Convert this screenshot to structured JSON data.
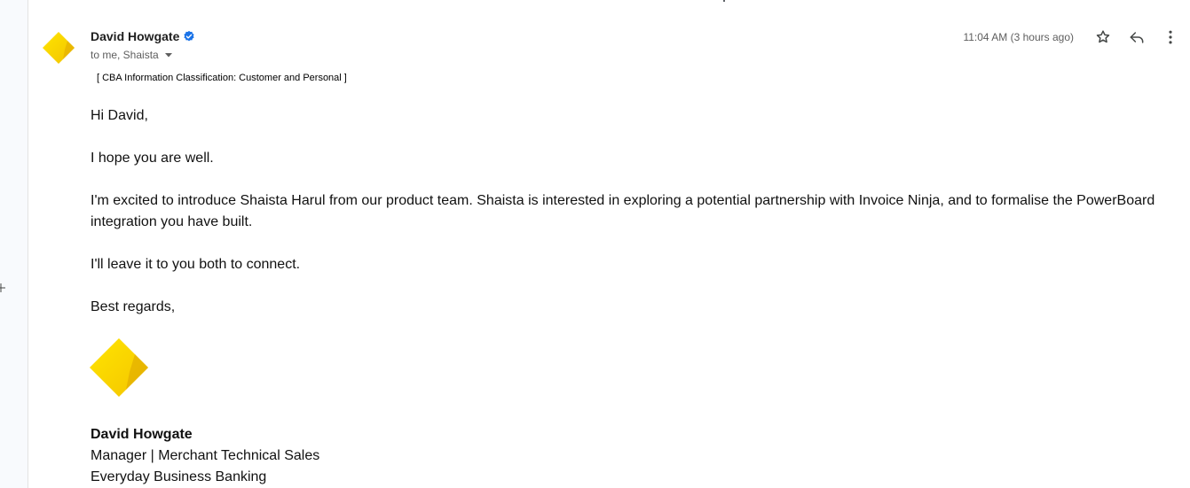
{
  "email": {
    "sender_name": "David Howgate",
    "recipients": "to me, Shaista",
    "timestamp": "11:04 AM (3 hours ago)",
    "classification": "[ CBA Information Classification: Customer and Personal ]",
    "body": {
      "greeting": "Hi David,",
      "line1": "I hope you are well.",
      "line2": "I'm excited to introduce Shaista Harul from our product team. Shaista is interested in exploring a potential partnership with Invoice Ninja, and to formalise the PowerBoard integration you have built.",
      "line3": "I'll leave it to you both to connect.",
      "closing": "Best regards,"
    },
    "signature": {
      "name": "David Howgate",
      "title": "Manager | Merchant Technical Sales",
      "department": "Everyday Business Banking"
    }
  },
  "icons": {
    "avatar": "cba-diamond-logo",
    "verified": "verified-badge-icon",
    "star": "star-icon",
    "reply": "reply-icon",
    "more": "more-vert-icon",
    "expand": "chevron-down-icon"
  },
  "colors": {
    "brand_yellow": "#FFD400",
    "verified_blue": "#1a73e8"
  }
}
